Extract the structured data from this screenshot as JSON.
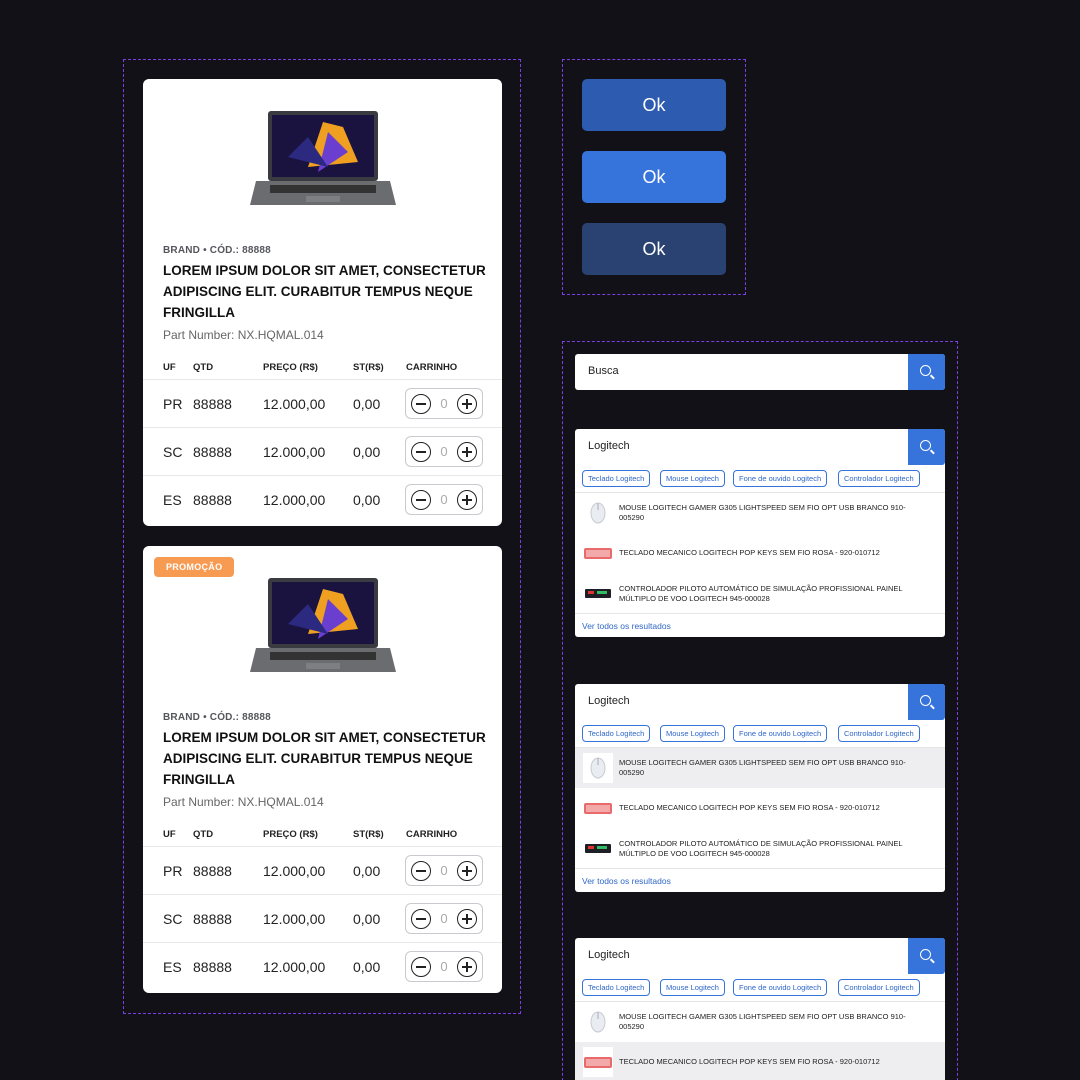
{
  "product_cards": [
    {
      "badge": "",
      "meta": "BRAND • CÓD.: 88888",
      "title": "LOREM IPSUM DOLOR SIT AMET, CONSECTETUR ADIPISCING ELIT. CURABITUR TEMPUS NEQUE FRINGILLA",
      "part_number": "Part Number: NX.HQMAL.014",
      "headers": [
        "UF",
        "QTD",
        "PREÇO (R$)",
        "ST(R$)",
        "CARRINHO"
      ],
      "rows": [
        {
          "uf": "PR",
          "qtd": "88888",
          "preco": "12.000,00",
          "st": "0,00",
          "cart": "0"
        },
        {
          "uf": "SC",
          "qtd": "88888",
          "preco": "12.000,00",
          "st": "0,00",
          "cart": "0"
        },
        {
          "uf": "ES",
          "qtd": "88888",
          "preco": "12.000,00",
          "st": "0,00",
          "cart": "0"
        }
      ]
    },
    {
      "badge": "PROMOÇÃO",
      "meta": "BRAND • CÓD.: 88888",
      "title": "LOREM IPSUM DOLOR SIT AMET, CONSECTETUR ADIPISCING ELIT. CURABITUR TEMPUS NEQUE FRINGILLA",
      "part_number": "Part Number: NX.HQMAL.014",
      "headers": [
        "UF",
        "QTD",
        "PREÇO (R$)",
        "ST(R$)",
        "CARRINHO"
      ],
      "rows": [
        {
          "uf": "PR",
          "qtd": "88888",
          "preco": "12.000,00",
          "st": "0,00",
          "cart": "0"
        },
        {
          "uf": "SC",
          "qtd": "88888",
          "preco": "12.000,00",
          "st": "0,00",
          "cart": "0"
        },
        {
          "uf": "ES",
          "qtd": "88888",
          "preco": "12.000,00",
          "st": "0,00",
          "cart": "0"
        }
      ]
    }
  ],
  "buttons": [
    {
      "label": "Ok",
      "state": "default",
      "color": "#2d5bb0"
    },
    {
      "label": "Ok",
      "state": "hover",
      "color": "#3674dc"
    },
    {
      "label": "Ok",
      "state": "pressed",
      "color": "#2a4272"
    }
  ],
  "search_empty": {
    "placeholder": "Busca"
  },
  "search_dropdowns": [
    {
      "query": "Logitech",
      "chips": [
        "Teclado Logitech",
        "Mouse Logitech",
        "Fone de ouvido Logitech",
        "Controlador Logitech"
      ],
      "results": [
        {
          "text": "MOUSE LOGITECH GAMER G305 LIGHTSPEED SEM FIO OPT USB BRANCO 910-005290",
          "icon": "mouse-thumb"
        },
        {
          "text": "TECLADO MECANICO LOGITECH POP KEYS SEM FIO ROSA - 920-010712",
          "icon": "keyboard-thumb"
        },
        {
          "text": "CONTROLADOR PILOTO AUTOMÁTICO DE SIMULAÇÃO PROFISSIONAL PAINEL MÚLTIPLO DE VOO LOGITECH 945-000028",
          "icon": "panel-thumb"
        }
      ],
      "see_all": "Ver todos os resultados",
      "highlighted": -1
    },
    {
      "query": "Logitech",
      "chips": [
        "Teclado Logitech",
        "Mouse Logitech",
        "Fone de ouvido Logitech",
        "Controlador Logitech"
      ],
      "results": [
        {
          "text": "MOUSE LOGITECH GAMER G305 LIGHTSPEED SEM FIO OPT USB BRANCO 910-005290",
          "icon": "mouse-thumb"
        },
        {
          "text": "TECLADO MECANICO LOGITECH POP KEYS SEM FIO ROSA - 920-010712",
          "icon": "keyboard-thumb"
        },
        {
          "text": "CONTROLADOR PILOTO AUTOMÁTICO DE SIMULAÇÃO PROFISSIONAL PAINEL MÚLTIPLO DE VOO LOGITECH 945-000028",
          "icon": "panel-thumb"
        }
      ],
      "see_all": "Ver todos os resultados",
      "highlighted": 0
    },
    {
      "query": "Logitech",
      "chips": [
        "Teclado Logitech",
        "Mouse Logitech",
        "Fone de ouvido Logitech",
        "Controlador Logitech"
      ],
      "results": [
        {
          "text": "MOUSE LOGITECH GAMER G305 LIGHTSPEED SEM FIO OPT USB BRANCO 910-005290",
          "icon": "mouse-thumb"
        },
        {
          "text": "TECLADO MECANICO LOGITECH POP KEYS SEM FIO ROSA - 920-010712",
          "icon": "keyboard-thumb"
        }
      ],
      "see_all": "",
      "highlighted": 1
    }
  ]
}
